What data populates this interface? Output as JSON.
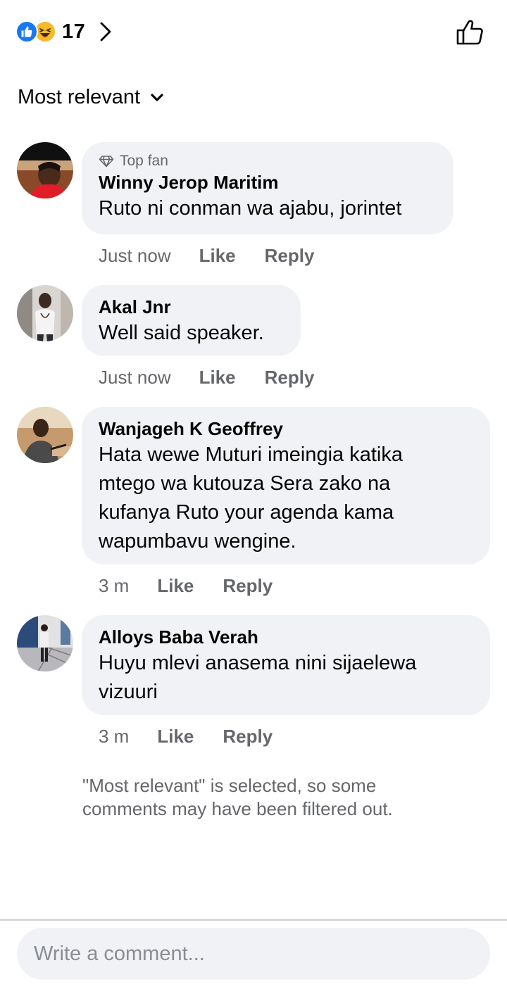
{
  "reactions": {
    "count": "17",
    "types": [
      "like-icon",
      "haha-icon"
    ],
    "like_color": "#1877F2",
    "haha_color": "#F7B928"
  },
  "sort": {
    "label": "Most relevant"
  },
  "comments": [
    {
      "badge": "Top fan",
      "author": "Winny Jerop Maritim",
      "lines": [
        "Ruto ni conman wa ajabu, jorintet"
      ],
      "time": "Just now",
      "like": "Like",
      "reply": "Reply"
    },
    {
      "author": "Akal Jnr",
      "lines": [
        "Well said speaker."
      ],
      "time": "Just now",
      "like": "Like",
      "reply": "Reply"
    },
    {
      "author": "Wanjageh K Geoffrey",
      "lines": [
        "Hata wewe Muturi imeingia katika",
        "mtego wa kutouza Sera zako na",
        "kufanya Ruto your agenda kama",
        "wapumbavu wengine."
      ],
      "time": "3 m",
      "like": "Like",
      "reply": "Reply"
    },
    {
      "author": "Alloys Baba Verah",
      "lines": [
        "Huyu mlevi anasema nini sijaelewa",
        "vizuuri"
      ],
      "time": "3 m",
      "like": "Like",
      "reply": "Reply"
    }
  ],
  "notice": {
    "line1": "\"Most relevant\" is selected, so some",
    "line2": "comments may have been filtered out."
  },
  "composer": {
    "placeholder": "Write a comment..."
  }
}
